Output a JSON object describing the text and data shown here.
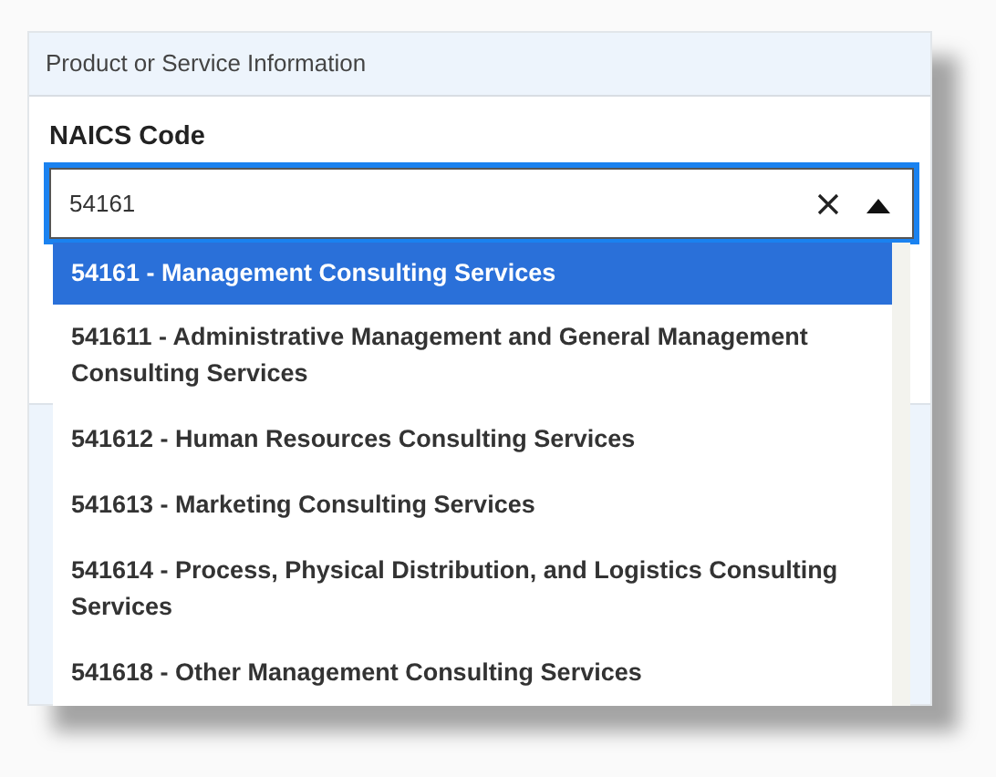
{
  "section": {
    "title": "Product or Service Information"
  },
  "field": {
    "label": "NAICS Code",
    "value": "54161",
    "expanded": true
  },
  "options": [
    {
      "label": "54161 - Management Consulting Services",
      "selected": true
    },
    {
      "label": "541611 - Administrative Management and General Management Consulting Services",
      "selected": false
    },
    {
      "label": "541612 - Human Resources Consulting Services",
      "selected": false
    },
    {
      "label": "541613 - Marketing Consulting Services",
      "selected": false
    },
    {
      "label": "541614 - Process, Physical Distribution, and Logistics Consulting Services",
      "selected": false
    },
    {
      "label": "541618 - Other Management Consulting Services",
      "selected": false
    }
  ]
}
